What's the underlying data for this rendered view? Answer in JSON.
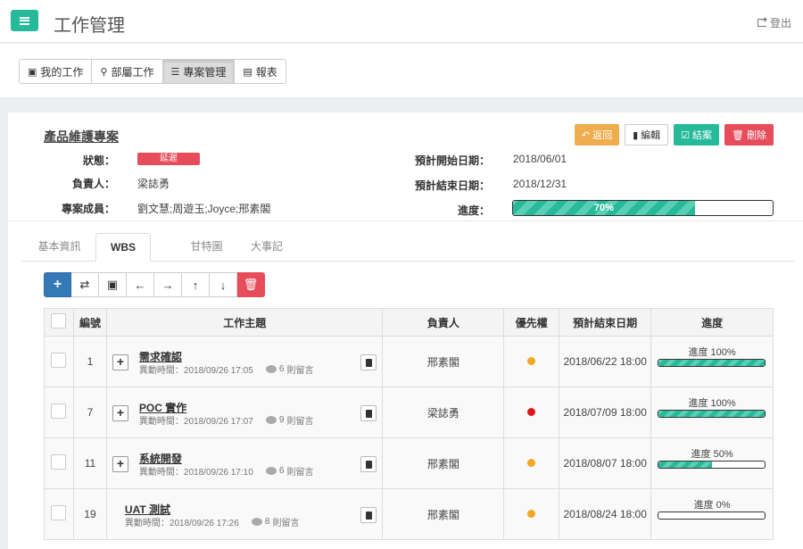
{
  "header": {
    "title": "工作管理",
    "logout_label": "登出"
  },
  "nav": {
    "tabs": [
      {
        "label": "我的工作",
        "icon": "id-card-icon"
      },
      {
        "label": "部屬工作",
        "icon": "sitemap-icon"
      },
      {
        "label": "專案管理",
        "icon": "list-alt-icon",
        "active": true
      },
      {
        "label": "報表",
        "icon": "report-icon"
      }
    ]
  },
  "project": {
    "title": "產品維護專案",
    "actions": {
      "back": "返回",
      "edit": "編輯",
      "close": "結案",
      "delete": "刪除"
    },
    "status_label": "狀態：",
    "status_value": "延遲",
    "owner_label": "負責人：",
    "owner_value": "梁誌勇",
    "members_label": "專案成員：",
    "members_value": "劉文慧;周遊玉;Joyce;邢素閣",
    "start_label": "預計開始日期：",
    "start_value": "2018/06/01",
    "end_label": "預計結束日期：",
    "end_value": "2018/12/31",
    "progress_label": "進度：",
    "progress_text": "70%",
    "progress_value": 0.7
  },
  "subtabs": [
    "基本資訊",
    "WBS",
    "甘特圖",
    "大事記"
  ],
  "table": {
    "headers": {
      "no": "編號",
      "topic": "工作主題",
      "owner": "負責人",
      "priority": "優先權",
      "end": "預計結束日期",
      "progress": "進度"
    },
    "rows": [
      {
        "no": "1",
        "name": "需求確認",
        "meta": "異動時間：2018/09/26 17:05",
        "comments": "6",
        "comments_suffix": "則留言",
        "owner": "邢素閣",
        "priority_color": "#f5a623",
        "end": "2018/06/22 18:00",
        "progress_text": "進度 100%",
        "progress": 1.0,
        "expandable": true
      },
      {
        "no": "7",
        "name": "POC 實作",
        "meta": "異動時間：2018/09/26 17:07",
        "comments": "9",
        "comments_suffix": "則留言",
        "owner": "梁誌勇",
        "priority_color": "#e0161c",
        "end": "2018/07/09 18:00",
        "progress_text": "進度 100%",
        "progress": 1.0,
        "expandable": true
      },
      {
        "no": "11",
        "name": "系統開發",
        "meta": "異動時間：2018/09/26 17:10",
        "comments": "6",
        "comments_suffix": "則留言",
        "owner": "邢素閣",
        "priority_color": "#f5a623",
        "end": "2018/08/07 18:00",
        "progress_text": "進度 50%",
        "progress": 0.5,
        "expandable": true
      },
      {
        "no": "19",
        "name": "UAT 測試",
        "meta": "異動時間：2018/09/26 17:26",
        "comments": "8",
        "comments_suffix": "則留言",
        "owner": "邢素閣",
        "priority_color": "#f5a623",
        "end": "2018/08/24 18:00",
        "progress_text": "進度 0%",
        "progress": 0.0,
        "expandable": false
      }
    ]
  },
  "colors": {
    "accent": "#26b99a",
    "danger": "#e74c5b",
    "warning": "#f0ad4e",
    "primary": "#337ab7"
  }
}
